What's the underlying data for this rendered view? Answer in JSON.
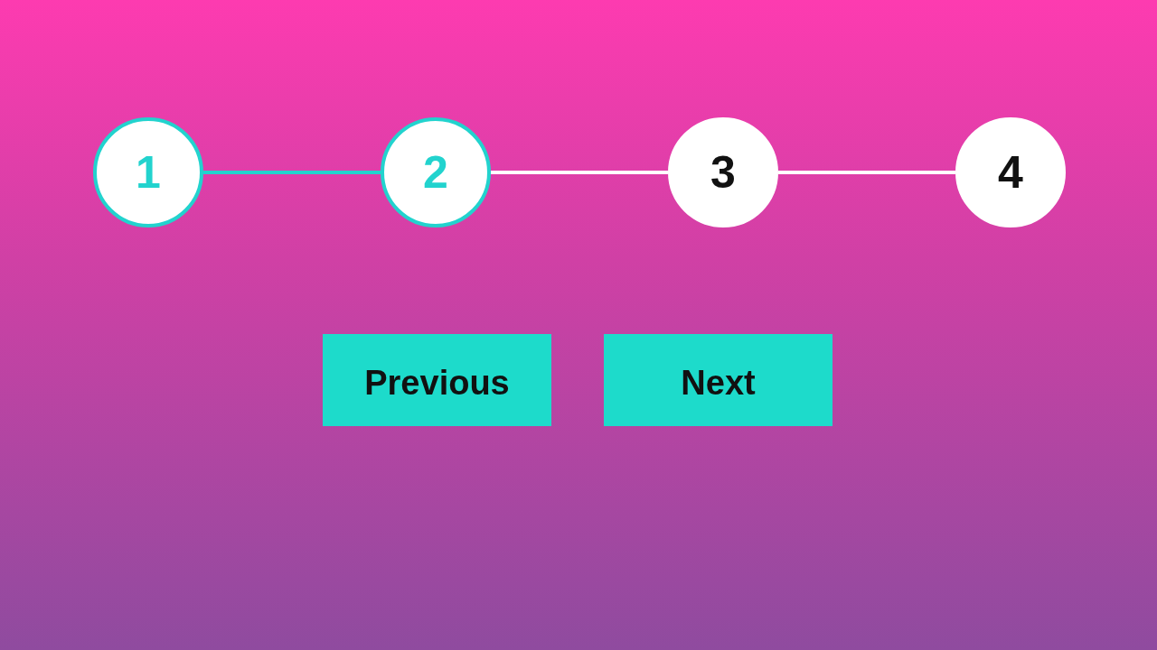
{
  "steps": [
    {
      "label": "1",
      "active": true
    },
    {
      "label": "2",
      "active": true
    },
    {
      "label": "3",
      "active": false
    },
    {
      "label": "4",
      "active": false
    }
  ],
  "buttons": [
    {
      "label": "Previous"
    },
    {
      "label": "Next"
    }
  ]
}
